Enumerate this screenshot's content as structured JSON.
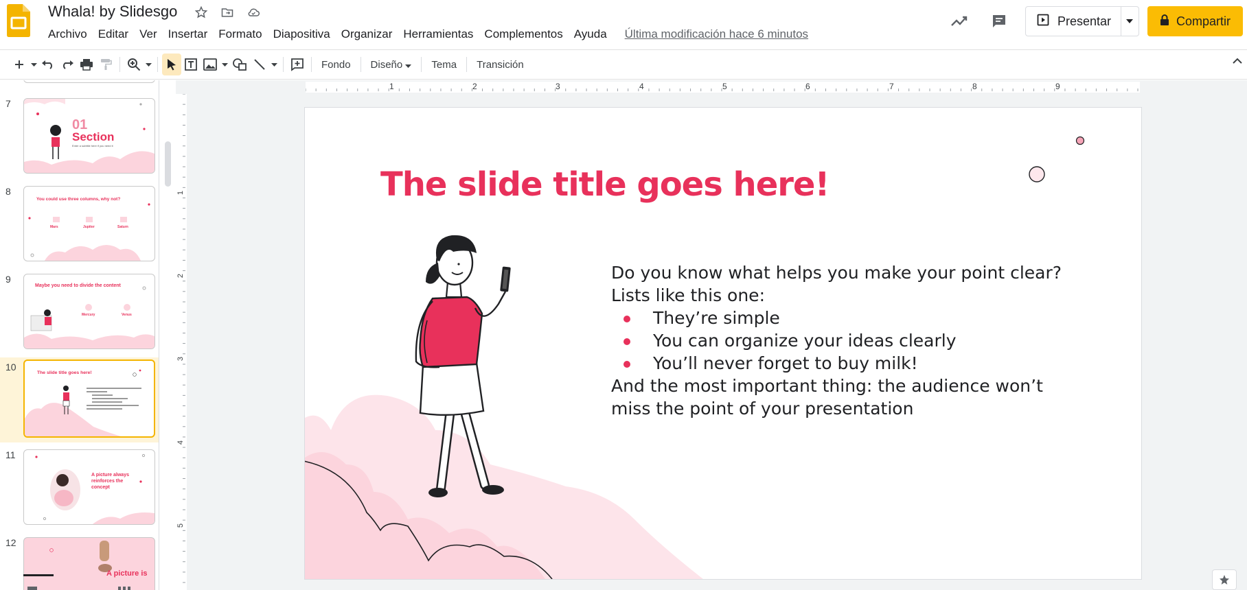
{
  "app": {
    "doc_title": "Whala! by Slidesgo",
    "last_edit": "Última modificación hace 6 minutos",
    "accent_color": "#fbbc04",
    "brand_color": "#f4b400"
  },
  "menu": [
    "Archivo",
    "Editar",
    "Ver",
    "Insertar",
    "Formato",
    "Diapositiva",
    "Organizar",
    "Herramientas",
    "Complementos",
    "Ayuda"
  ],
  "header_actions": {
    "present_label": "Presentar",
    "share_label": "Compartir"
  },
  "toolbar": {
    "background_label": "Fondo",
    "layout_label": "Diseño",
    "theme_label": "Tema",
    "transition_label": "Transición",
    "ruler_numbers": [
      "1",
      "2",
      "3",
      "4",
      "5",
      "6",
      "7",
      "8",
      "9"
    ],
    "ruler_side_numbers": [
      "1",
      "2",
      "3",
      "4",
      "5"
    ]
  },
  "filmstrip": {
    "selected_slide": "10",
    "slides": [
      {
        "number": "7",
        "thumb_title": "01",
        "thumb_subtitle": "Section",
        "thumb_caption": "Enter a subtitle here if you need it"
      },
      {
        "number": "8",
        "thumb_title": "You could use three columns, why not?",
        "thumb_cols": [
          "Mars",
          "Jupiter",
          "Saturn"
        ]
      },
      {
        "number": "9",
        "thumb_title": "Maybe you need to divide the content",
        "thumb_cols": [
          "Mercury",
          "Venus"
        ]
      },
      {
        "number": "10",
        "thumb_title": "The slide title goes here!"
      },
      {
        "number": "11",
        "thumb_title": "A picture always reinforces the concept"
      },
      {
        "number": "12",
        "thumb_title": "A picture is"
      }
    ]
  },
  "slide": {
    "title": "The slide title goes here!",
    "intro_1": "Do you know what helps you make your point clear?",
    "intro_2": "Lists like this one:",
    "bullets": [
      "They’re simple",
      "You can organize your ideas clearly",
      "You’ll never forget to buy milk!"
    ],
    "outro_1": "And the most important thing: the audience won’t",
    "outro_2": "miss the point of your presentation",
    "title_color": "#e8315b",
    "cloud_color": "#fcd4dd"
  }
}
